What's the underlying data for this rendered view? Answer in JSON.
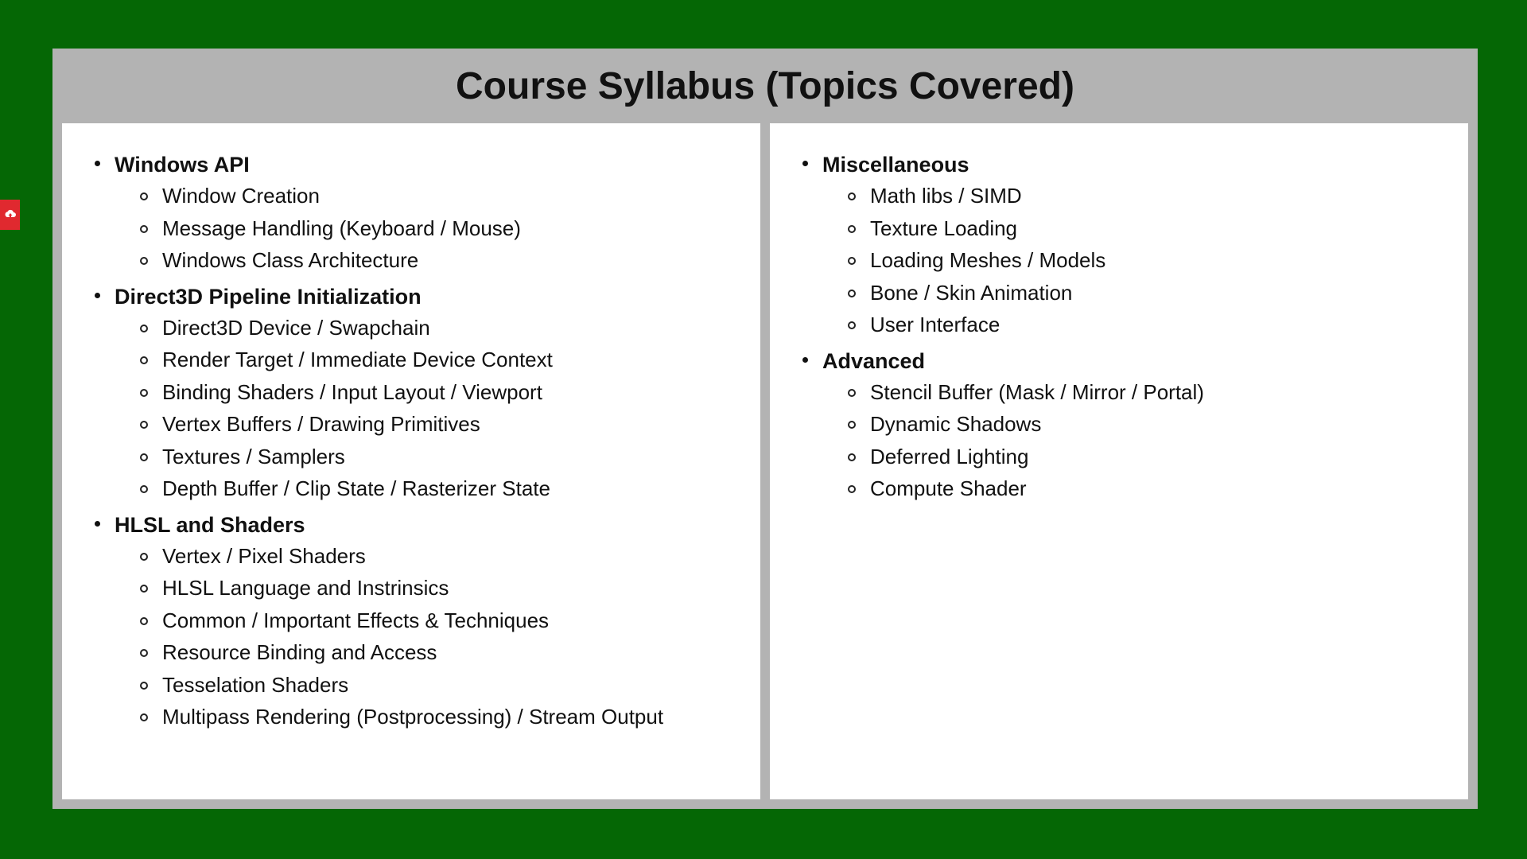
{
  "title": "Course Syllabus (Topics Covered)",
  "colors": {
    "background": "#056705",
    "frame": "#b3b3b3",
    "panel": "#ffffff",
    "side_tab": "#e0292f"
  },
  "side_tab_icon": "upload-cloud-icon",
  "columns": [
    {
      "topics": [
        {
          "title": "Windows API",
          "items": [
            "Window Creation",
            "Message Handling (Keyboard / Mouse)",
            "Windows Class Architecture"
          ]
        },
        {
          "title": "Direct3D Pipeline Initialization",
          "items": [
            "Direct3D Device / Swapchain",
            "Render Target / Immediate Device Context",
            "Binding Shaders / Input Layout / Viewport",
            "Vertex Buffers / Drawing Primitives",
            "Textures / Samplers",
            "Depth Buffer / Clip State / Rasterizer State"
          ]
        },
        {
          "title": "HLSL and Shaders",
          "items": [
            "Vertex / Pixel Shaders",
            "HLSL Language and Instrinsics",
            "Common / Important Effects & Techniques",
            "Resource Binding and Access",
            "Tesselation Shaders",
            "Multipass Rendering (Postprocessing) / Stream Output"
          ]
        }
      ]
    },
    {
      "topics": [
        {
          "title": "Miscellaneous",
          "items": [
            "Math libs / SIMD",
            "Texture Loading",
            "Loading Meshes / Models",
            "Bone / Skin Animation",
            "User Interface"
          ]
        },
        {
          "title": "Advanced",
          "items": [
            "Stencil Buffer (Mask / Mirror / Portal)",
            "Dynamic Shadows",
            "Deferred Lighting",
            "Compute Shader"
          ]
        }
      ]
    }
  ]
}
